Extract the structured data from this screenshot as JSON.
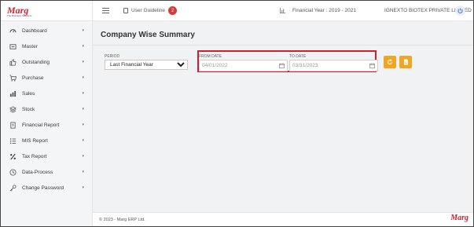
{
  "brand": {
    "logo": "Marg",
    "tagline": "The Business Solutions"
  },
  "sidebar": {
    "items": [
      {
        "label": "Dashboard",
        "icon": "dashboard-icon"
      },
      {
        "label": "Master",
        "icon": "master-icon"
      },
      {
        "label": "Outstanding",
        "icon": "thumbs-up-icon"
      },
      {
        "label": "Purchase",
        "icon": "cart-icon"
      },
      {
        "label": "Sales",
        "icon": "sales-icon"
      },
      {
        "label": "Stock",
        "icon": "stack-icon"
      },
      {
        "label": "Financial Report",
        "icon": "document-icon"
      },
      {
        "label": "MIS Report",
        "icon": "list-icon"
      },
      {
        "label": "Tax Report",
        "icon": "percent-icon"
      },
      {
        "label": "Data-Process",
        "icon": "clock-icon"
      },
      {
        "label": "Change Password",
        "icon": "key-icon"
      }
    ]
  },
  "header": {
    "guide_label": "User Guideline",
    "guide_badge": "2",
    "financial_year": "Financial Year : 2019 - 2021",
    "company": "IGNEXTO BIOTEX PRIVATE LIMITED"
  },
  "main": {
    "title": "Company Wise Summary",
    "period_label": "PERIOD",
    "period_value": "Last Financial Year",
    "from_label": "FROM DATE",
    "from_value": "04/01/2022",
    "to_label": "TO DATE",
    "to_value": "03/31/2023"
  },
  "footer": {
    "copyright": "© 2023 - Marg ERP Ltd.",
    "logo": "Marg"
  },
  "colors": {
    "accent": "#f0a623",
    "highlight": "#d0202e",
    "badge": "#d33a3a"
  }
}
